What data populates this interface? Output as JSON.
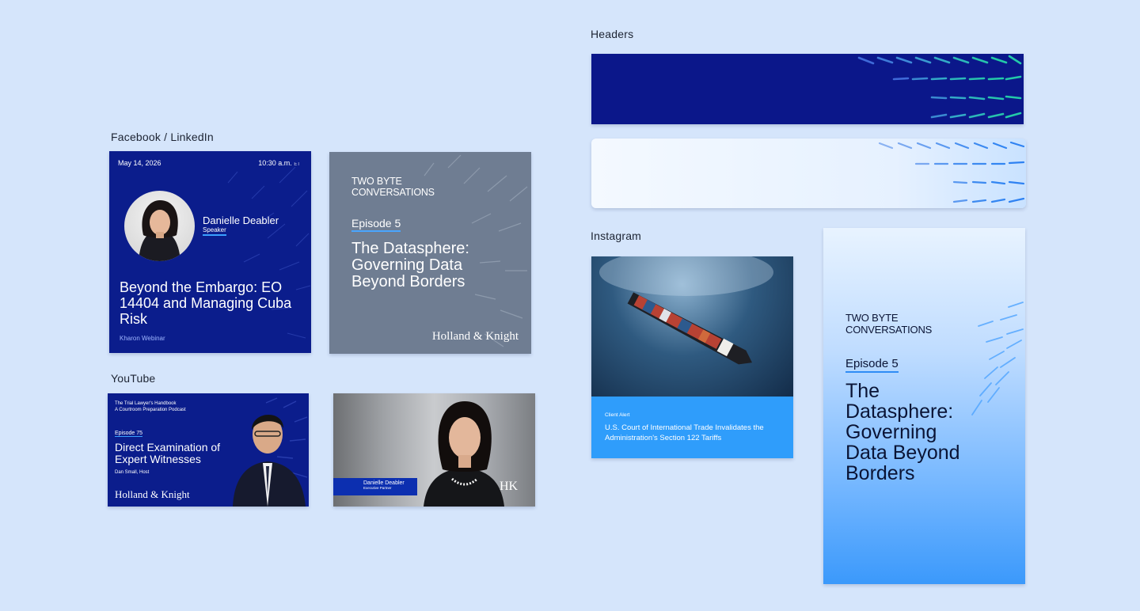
{
  "sections": {
    "facebook_linkedin": "Facebook / LinkedIn",
    "youtube": "YouTube",
    "headers": "Headers",
    "instagram": "Instagram"
  },
  "fb_webinar": {
    "date": "May 14, 2026",
    "time": "10:30 a.m.",
    "time_zone": "ET",
    "speaker_name": "Danielle Deabler",
    "speaker_role": "Speaker",
    "title": "Beyond the Embargo: EO 14404 and Managing Cuba Risk",
    "subtitle": "Kharon Webinar"
  },
  "fb_podcast": {
    "series": "TWO BYTE CONVERSATIONS",
    "episode": "Episode 5",
    "title": "The Datasphere: Governing Data Beyond Borders",
    "logo": "Holland & Knight"
  },
  "yt_podcast": {
    "series_line1": "The Trial Lawyer's Handbook",
    "series_line2": "A Courtroom Preparation Podcast",
    "episode": "Episode 75",
    "title": "Direct Examination of Expert Witnesses",
    "host": "Dan Small, Host",
    "logo": "Holland & Knight"
  },
  "yt_interview": {
    "name": "Danielle Deabler",
    "role": "Executive Partner",
    "logo": "HK"
  },
  "ig_alert": {
    "label": "Client Alert",
    "headline": "U.S. Court of International Trade Invalidates the Administration's Section 122 Tariffs"
  },
  "ig_story": {
    "series": "TWO BYTE CONVERSATIONS",
    "episode": "Episode 5",
    "title": "The Datasphere: Governing Data Beyond Borders"
  },
  "colors": {
    "background": "#d5e5fb",
    "navy": "#0b1d8c",
    "accent_blue": "#2f9dfb",
    "slate": "#6f7d92",
    "teal": "#23c9a8"
  }
}
